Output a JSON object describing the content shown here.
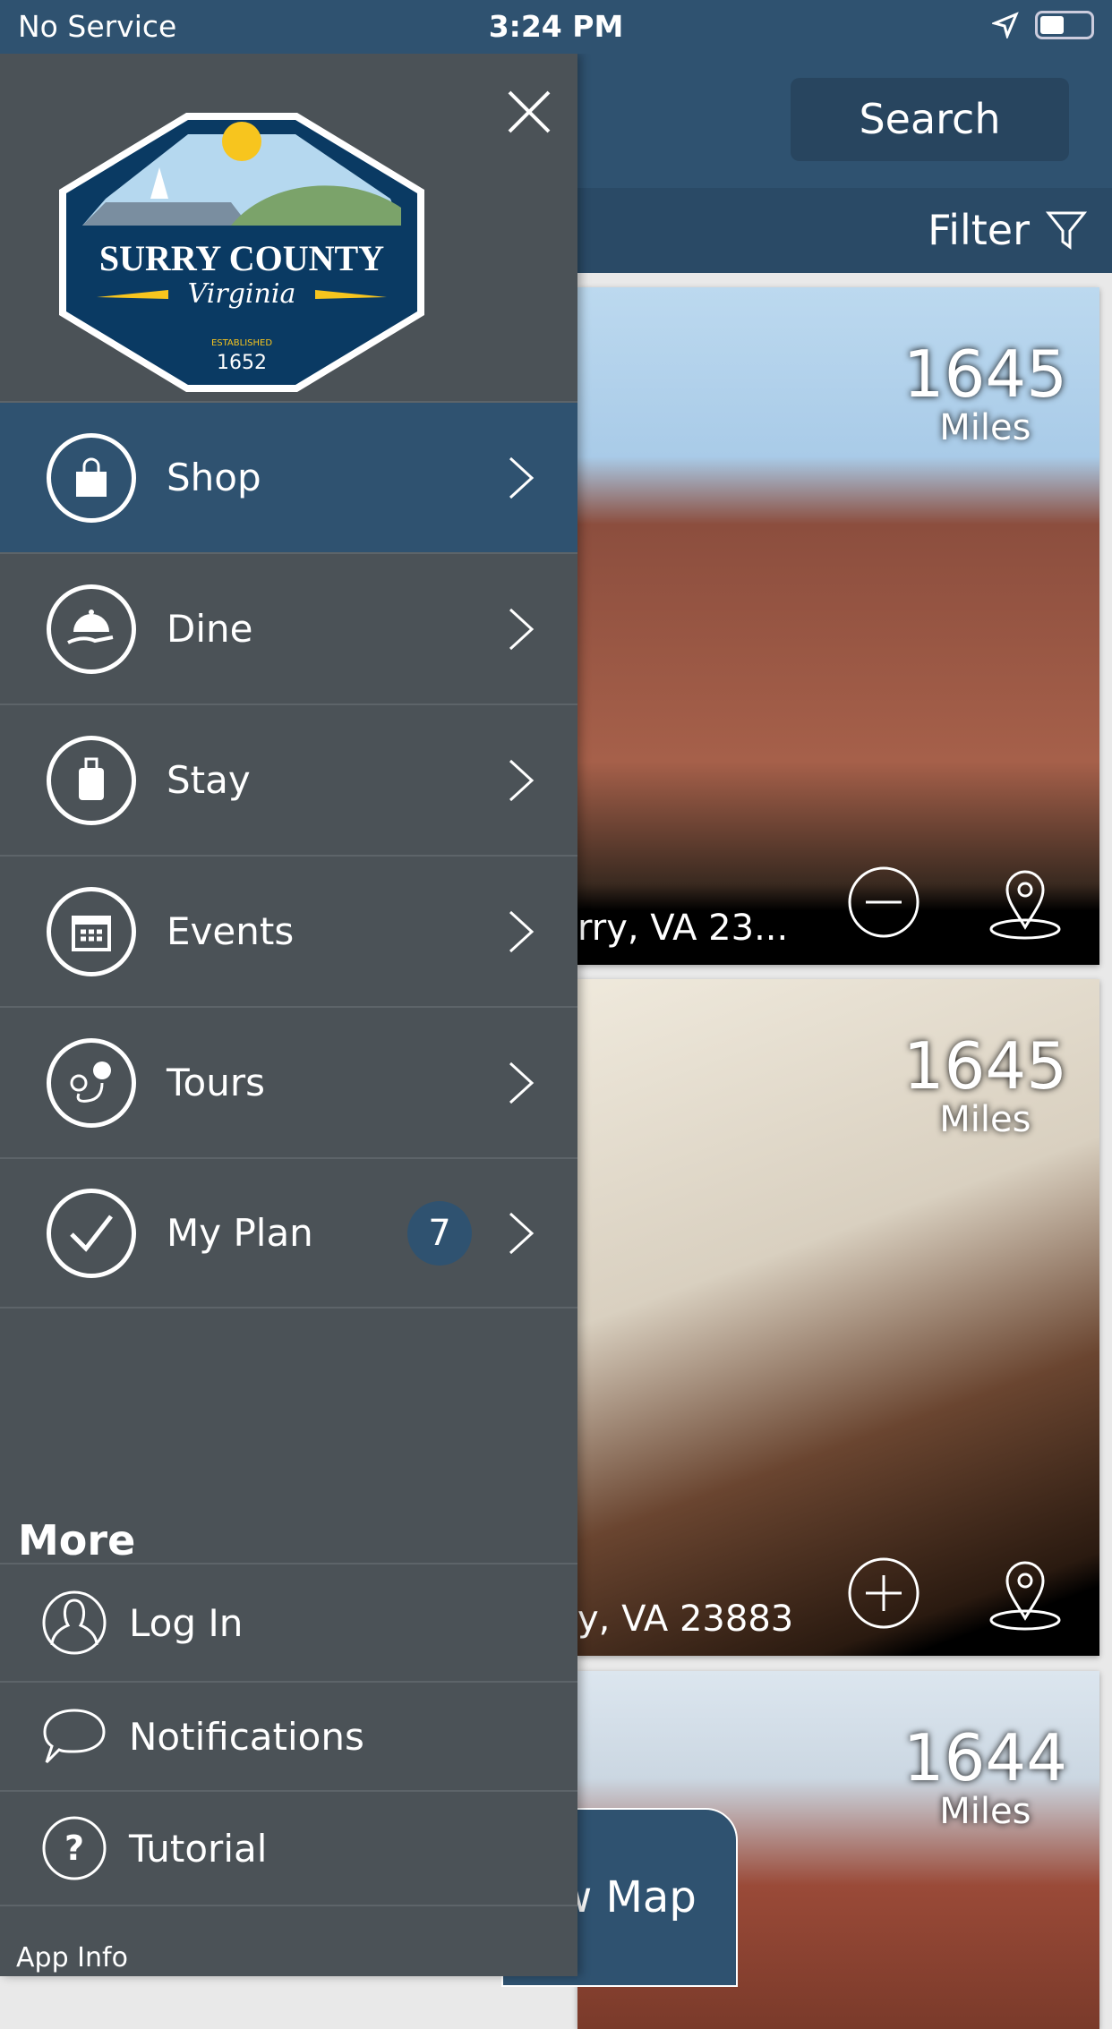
{
  "status_bar": {
    "carrier": "No Service",
    "time": "3:24 PM"
  },
  "header": {
    "search_label": "Search",
    "filter_label": "Filter"
  },
  "cards": [
    {
      "distance": "1645",
      "unit": "Miles",
      "address": "rry, VA 23...",
      "action": "remove"
    },
    {
      "distance": "1645",
      "unit": "Miles",
      "address": "y, VA 23883",
      "action": "add"
    },
    {
      "distance": "1644",
      "unit": "Miles"
    }
  ],
  "map_button": {
    "label": "w Map"
  },
  "drawer": {
    "logo": {
      "name": "SURRY COUNTY",
      "sub": "Virginia",
      "established": "ESTABLISHED",
      "year": "1652"
    },
    "menu": [
      {
        "label": "Shop",
        "icon": "shopping-bag-icon",
        "active": true
      },
      {
        "label": "Dine",
        "icon": "cloche-icon"
      },
      {
        "label": "Stay",
        "icon": "luggage-icon"
      },
      {
        "label": "Events",
        "icon": "calendar-icon"
      },
      {
        "label": "Tours",
        "icon": "route-icon"
      },
      {
        "label": "My Plan",
        "icon": "check-icon",
        "badge": "7"
      }
    ],
    "more_heading": "More",
    "more": [
      {
        "label": "Log In",
        "icon": "user-icon"
      },
      {
        "label": "Notifications",
        "icon": "chat-bubble-icon"
      },
      {
        "label": "Tutorial",
        "icon": "question-icon"
      }
    ],
    "app_info": "App Info"
  },
  "colors": {
    "primary": "#2f5270",
    "drawer": "#4b5257"
  }
}
